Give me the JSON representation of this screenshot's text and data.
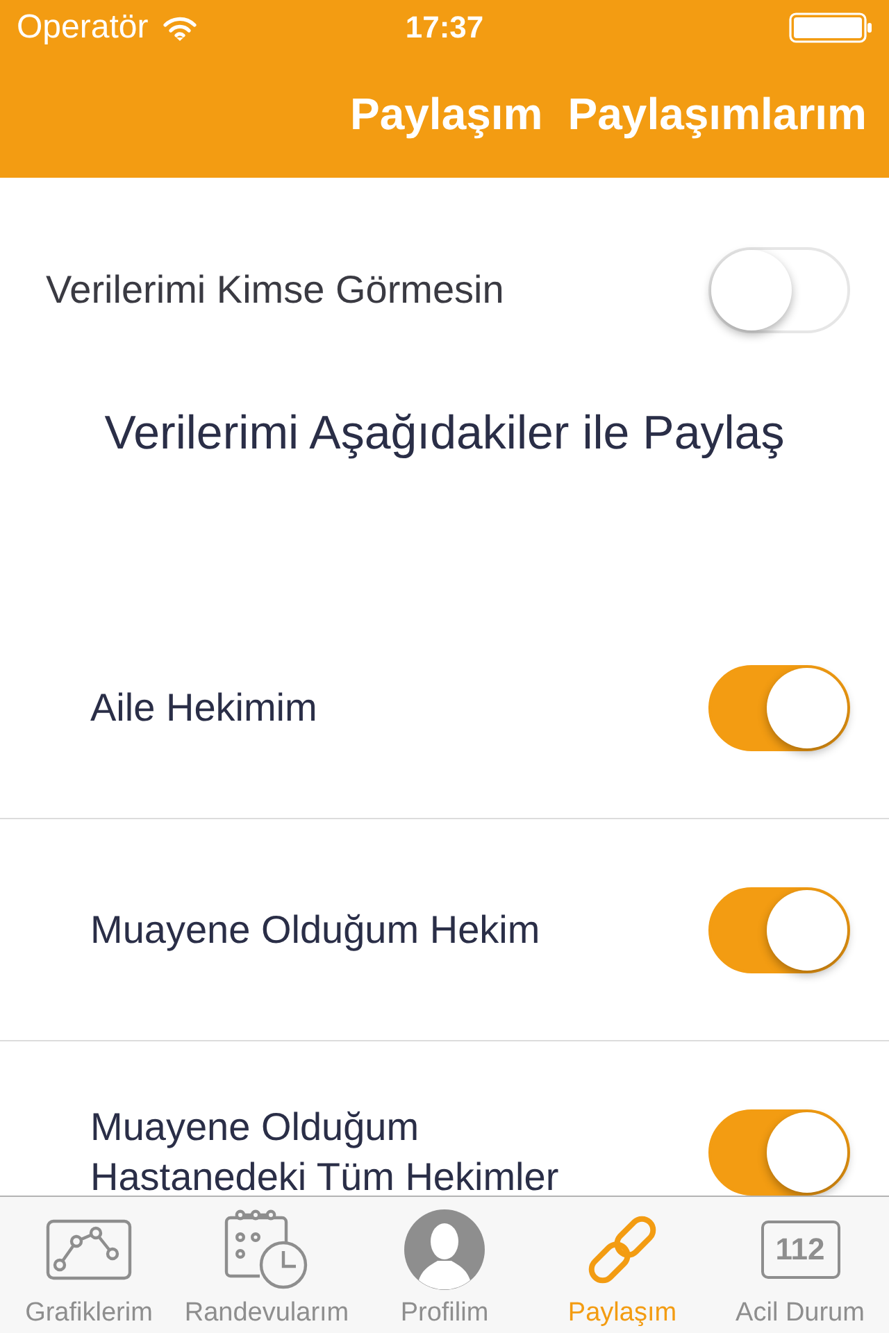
{
  "status_bar": {
    "carrier": "Operatör",
    "time": "17:37"
  },
  "nav_bar": {
    "buttons": [
      "Paylaşım",
      "Paylaşımlarım"
    ]
  },
  "privacy": {
    "label": "Verilerimi Kimse Görmesin",
    "on": false
  },
  "share_heading": "Verilerimi Aşağıdakiler ile Paylaş",
  "share_targets": [
    {
      "label": "Aile Hekimim",
      "on": true
    },
    {
      "label": "Muayene Olduğum Hekim",
      "on": true
    },
    {
      "label": "Muayene Olduğum Hastanedeki Tüm Hekimler",
      "on": true
    }
  ],
  "tab_bar": [
    {
      "label": "Grafiklerim",
      "kind": "chart",
      "selected": false
    },
    {
      "label": "Randevularım",
      "kind": "calendar",
      "selected": false
    },
    {
      "label": "Profilim",
      "kind": "profile",
      "selected": false
    },
    {
      "label": "Paylaşım",
      "kind": "link",
      "selected": true
    },
    {
      "label": "Acil Durum",
      "kind": "number",
      "icon_text": "112",
      "selected": false
    }
  ]
}
